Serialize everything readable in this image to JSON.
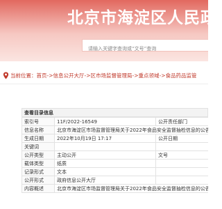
{
  "banner": {
    "title": "北京市海淀区人民政"
  },
  "search": {
    "placeholder": "请输入关键字查询或“文号”查询"
  },
  "breadcrumb": {
    "prefix": "当前位置：",
    "items": [
      "首页",
      "信息公开大厅",
      "区市场监督管理局",
      "重点领域",
      "食品药品监管"
    ],
    "separator": "->"
  },
  "section_title": "查看目录信息",
  "rows": [
    {
      "label": "索引号",
      "value": "11F/2022-16549",
      "label2": "公开责任部门",
      "value2": ""
    },
    {
      "label": "信息名称",
      "value": "北京市海淀区市场监督管理局关于2022年食品安全监督抽检信息的公告",
      "label2": "",
      "value2": ""
    },
    {
      "label": "生成日期",
      "value": "2022年10月19日 17:17",
      "label2": "公开日期",
      "value2": ""
    },
    {
      "label": "关键词",
      "value": "",
      "label2": "",
      "value2": ""
    },
    {
      "label": "公开类型",
      "value": "主动公开",
      "label2": "文号",
      "value2": ""
    },
    {
      "label": "载体类型",
      "value": "纸质",
      "label2": "",
      "value2": ""
    },
    {
      "label": "记录形式",
      "value": "文本",
      "label2": "",
      "value2": ""
    },
    {
      "label": "公开形式",
      "value": "政府信息公开大厅",
      "label2": "",
      "value2": ""
    },
    {
      "label": "内容概述",
      "value": "北京市海淀区市场监督管理局关于2022年食品安全监督抽检信息的公告",
      "label2": "",
      "value2": ""
    }
  ]
}
